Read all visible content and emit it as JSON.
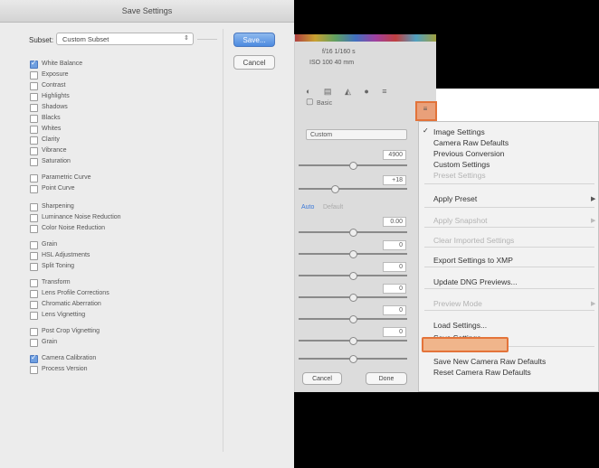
{
  "dialog": {
    "title": "Save Settings",
    "subset_label": "Subset:",
    "subset_value": "Custom Subset",
    "save_label": "Save...",
    "cancel_label": "Cancel",
    "checkboxes": [
      {
        "label": "White Balance",
        "checked": true
      },
      {
        "label": "Exposure",
        "checked": false
      },
      {
        "label": "Contrast",
        "checked": false
      },
      {
        "label": "Highlights",
        "checked": false
      },
      {
        "label": "Shadows",
        "checked": false
      },
      {
        "label": "Blacks",
        "checked": false
      },
      {
        "label": "Whites",
        "checked": false
      },
      {
        "label": "Clarity",
        "checked": false
      },
      {
        "label": "Vibrance",
        "checked": false
      },
      {
        "label": "Saturation",
        "checked": false
      },
      {
        "label": "Parametric Curve",
        "checked": false
      },
      {
        "label": "Point Curve",
        "checked": false
      },
      {
        "label": "Sharpening",
        "checked": false
      },
      {
        "label": "Luminance Noise Reduction",
        "checked": false
      },
      {
        "label": "Color Noise Reduction",
        "checked": false
      },
      {
        "label": "Grain",
        "checked": false
      },
      {
        "label": "HSL Adjustments",
        "checked": false
      },
      {
        "label": "Split Toning",
        "checked": false
      },
      {
        "label": "Transform",
        "checked": false
      },
      {
        "label": "Lens Profile Corrections",
        "checked": false
      },
      {
        "label": "Chromatic Aberration",
        "checked": false
      },
      {
        "label": "Lens Vignetting",
        "checked": false
      },
      {
        "label": "Post Crop Vignetting",
        "checked": false
      },
      {
        "label": "Grain",
        "checked": false
      },
      {
        "label": "Camera Calibration",
        "checked": true
      },
      {
        "label": "Process Version",
        "checked": false
      }
    ]
  },
  "camera_raw": {
    "info_line1": "f/16   1/160 s",
    "info_line2": "ISO 100   40 mm",
    "tools_glyphs": "◐ ▤ ◭ ● ≡ ▢",
    "panel_label": "Basic",
    "white_balance_value": "Custom",
    "temperature_value": "4900",
    "tint_value": "+18",
    "auto_label": "Auto",
    "default_label": "Default",
    "exposure_value": "0.00",
    "slider_values": [
      "0",
      "0",
      "0",
      "0",
      "0",
      "0"
    ],
    "cancel_label": "Cancel",
    "done_label": "Done",
    "menu_icon": "≡"
  },
  "menu": {
    "items": [
      {
        "label": "Image Settings",
        "disabled": false,
        "checked": true
      },
      {
        "label": "Camera Raw Defaults",
        "disabled": false
      },
      {
        "label": "Previous Conversion",
        "disabled": false
      },
      {
        "label": "Custom Settings",
        "disabled": false
      },
      {
        "label": "Preset Settings",
        "disabled": true
      },
      {
        "label": "Apply Preset",
        "disabled": false,
        "submenu": true
      },
      {
        "label": "Apply Snapshot",
        "disabled": true,
        "submenu": true
      },
      {
        "label": "Clear Imported Settings",
        "disabled": true
      },
      {
        "label": "Export Settings to XMP",
        "disabled": false
      },
      {
        "label": "Update DNG Previews...",
        "disabled": false
      },
      {
        "label": "Preview Mode",
        "disabled": true,
        "submenu": true
      },
      {
        "label": "Load Settings...",
        "disabled": false
      },
      {
        "label": "Save Settings...",
        "disabled": false,
        "highlighted": true
      },
      {
        "label": "Save New Camera Raw Defaults",
        "disabled": false
      },
      {
        "label": "Reset Camera Raw Defaults",
        "disabled": false
      }
    ],
    "submenu_arrow": "▶"
  }
}
